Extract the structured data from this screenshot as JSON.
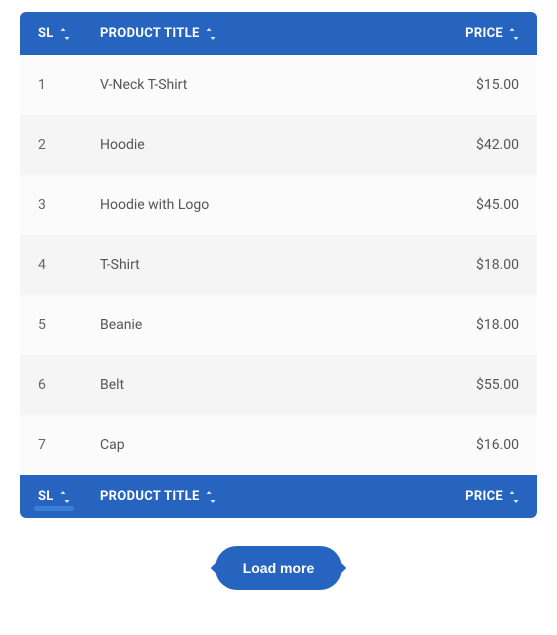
{
  "table": {
    "header": {
      "sl": "SL",
      "title": "PRODUCT TITLE",
      "price": "PRICE"
    },
    "footer": {
      "sl": "SL",
      "title": "PRODUCT TITLE",
      "price": "PRICE"
    },
    "rows": [
      {
        "sl": "1",
        "title": "V-Neck T-Shirt",
        "price": "$15.00"
      },
      {
        "sl": "2",
        "title": "Hoodie",
        "price": "$42.00"
      },
      {
        "sl": "3",
        "title": "Hoodie with Logo",
        "price": "$45.00"
      },
      {
        "sl": "4",
        "title": "T-Shirt",
        "price": "$18.00"
      },
      {
        "sl": "5",
        "title": "Beanie",
        "price": "$18.00"
      },
      {
        "sl": "6",
        "title": "Belt",
        "price": "$55.00"
      },
      {
        "sl": "7",
        "title": "Cap",
        "price": "$16.00"
      }
    ]
  },
  "actions": {
    "load_more": "Load more"
  }
}
